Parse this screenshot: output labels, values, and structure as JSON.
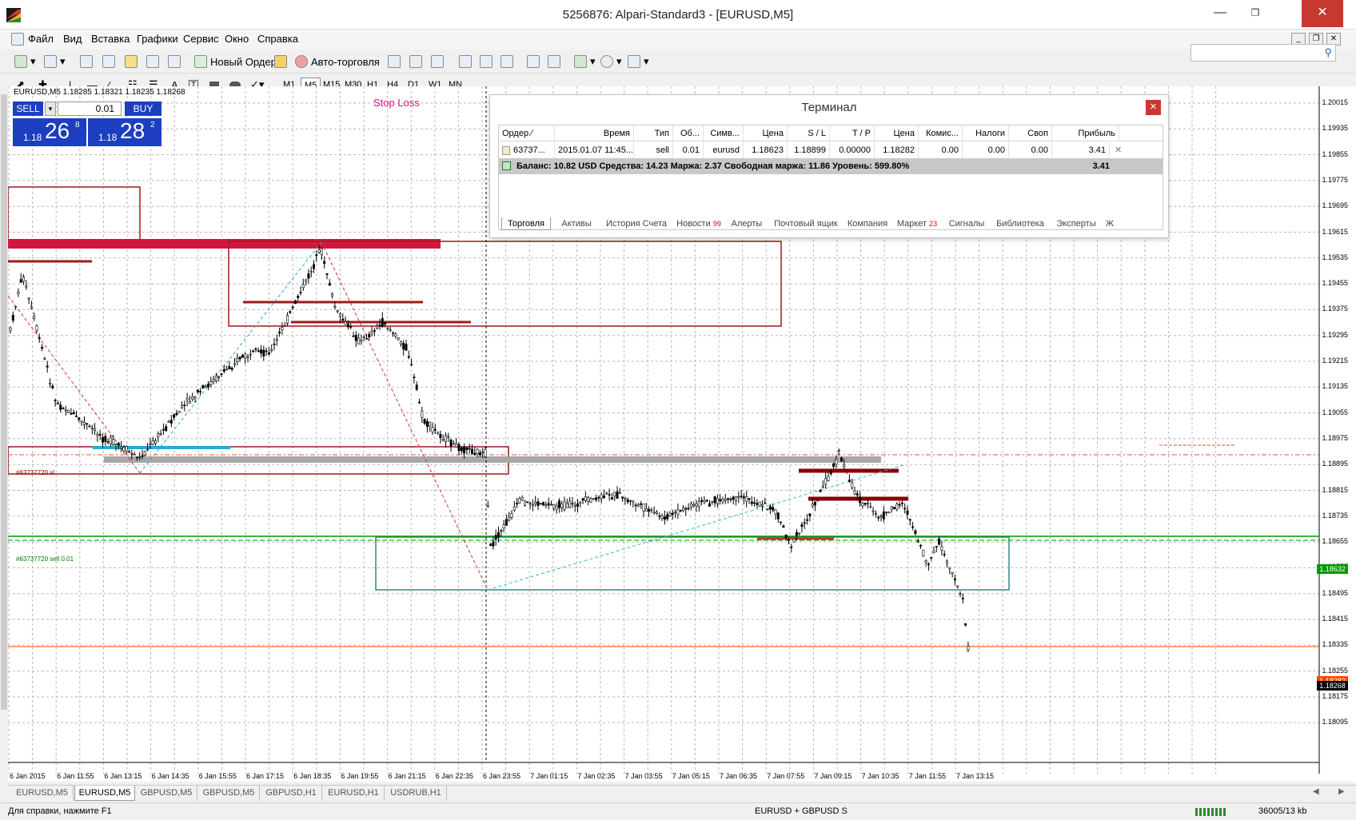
{
  "window": {
    "title": "5256876: Alpari-Standard3 - [EURUSD,M5]"
  },
  "menu": [
    "Файл",
    "Вид",
    "Вставка",
    "Графики",
    "Сервис",
    "Окно",
    "Справка"
  ],
  "toolbar": {
    "new_order": "Новый Ордер",
    "auto_trading": "Авто-торговля"
  },
  "timeframes": [
    "M1",
    "M5",
    "M15",
    "M30",
    "H1",
    "H4",
    "D1",
    "W1",
    "MN"
  ],
  "active_timeframe": "M5",
  "chart": {
    "header": "EURUSD,M5  1.18285 1.18321 1.18235 1.18268",
    "stop_loss_label": "Stop Loss",
    "sl_line_label": "#63737720 sl",
    "order_line_label": "#63737720 sell 0.01",
    "bid_price": "1.18268",
    "order_price": "1.18632",
    "red_price": "1.18282",
    "price_axis": [
      "1.20015",
      "1.19935",
      "1.19855",
      "1.19775",
      "1.19695",
      "1.19615",
      "1.19535",
      "1.19455",
      "1.19375",
      "1.19295",
      "1.19215",
      "1.19135",
      "1.19055",
      "1.18975",
      "1.18895",
      "1.18815",
      "1.18735",
      "1.18655",
      "1.18575",
      "1.18495",
      "1.18415",
      "1.18335",
      "1.18255",
      "1.18175",
      "1.18095"
    ],
    "time_axis": [
      "6 Jan 2015",
      "6 Jan 11:55",
      "6 Jan 13:15",
      "6 Jan 14:35",
      "6 Jan 15:55",
      "6 Jan 17:15",
      "6 Jan 18:35",
      "6 Jan 19:55",
      "6 Jan 21:15",
      "6 Jan 22:35",
      "6 Jan 23:55",
      "7 Jan 01:15",
      "7 Jan 02:35",
      "7 Jan 03:55",
      "7 Jan 05:15",
      "7 Jan 06:35",
      "7 Jan 07:55",
      "7 Jan 09:15",
      "7 Jan 10:35",
      "7 Jan 11:55",
      "7 Jan 13:15"
    ]
  },
  "one_click": {
    "sell_label": "SELL",
    "buy_label": "BUY",
    "lot": "0.01",
    "sell_prefix": "1.18",
    "sell_big": "26",
    "sell_sup": "8",
    "buy_prefix": "1.18",
    "buy_big": "28",
    "buy_sup": "2"
  },
  "terminal": {
    "title": "Терминал",
    "columns": [
      "Ордер",
      "Время",
      "Тип",
      "Об...",
      "Симв...",
      "Цена",
      "S / L",
      "T / P",
      "Цена",
      "Комис...",
      "Налоги",
      "Своп",
      "Прибыль"
    ],
    "order_row": [
      "63737...",
      "2015.01.07 11:45...",
      "sell",
      "0.01",
      "eurusd",
      "1.18623",
      "1.18899",
      "0.00000",
      "1.18282",
      "0.00",
      "0.00",
      "0.00",
      "3.41"
    ],
    "balance_row": "Баланс: 10.82 USD  Средства: 14.23  Маржа: 2.37  Свободная маржа: 11.86  Уровень: 599.80%",
    "balance_profit": "3.41",
    "tabs": [
      "Торговля",
      "Активы",
      "История Счета",
      "Новости",
      "Алерты",
      "Почтовый ящик",
      "Компания",
      "Маркет",
      "Сигналы",
      "Библиотека",
      "Эксперты",
      "Ж"
    ],
    "news_badge": "99",
    "market_badge": "23"
  },
  "chart_tabs": [
    "EURUSD,M5",
    "EURUSD,M5",
    "GBPUSD,M5",
    "GBPUSD,M5",
    "GBPUSD,H1",
    "EURUSD,H1",
    "USDRUB,H1"
  ],
  "active_chart_tab": 1,
  "status": {
    "help": "Для справки, нажмите F1",
    "profile": "EURUSD + GBPUSD S",
    "traffic": "36005/13 kb"
  },
  "colors": {
    "sell": "#1d3fbf",
    "close": "#c7392f",
    "sl_line": "#c00000",
    "order_line": "#009900",
    "bid_line": "#ff4500",
    "box_dark": "#9b1b1b",
    "box_teal": "#2a8a8a"
  }
}
